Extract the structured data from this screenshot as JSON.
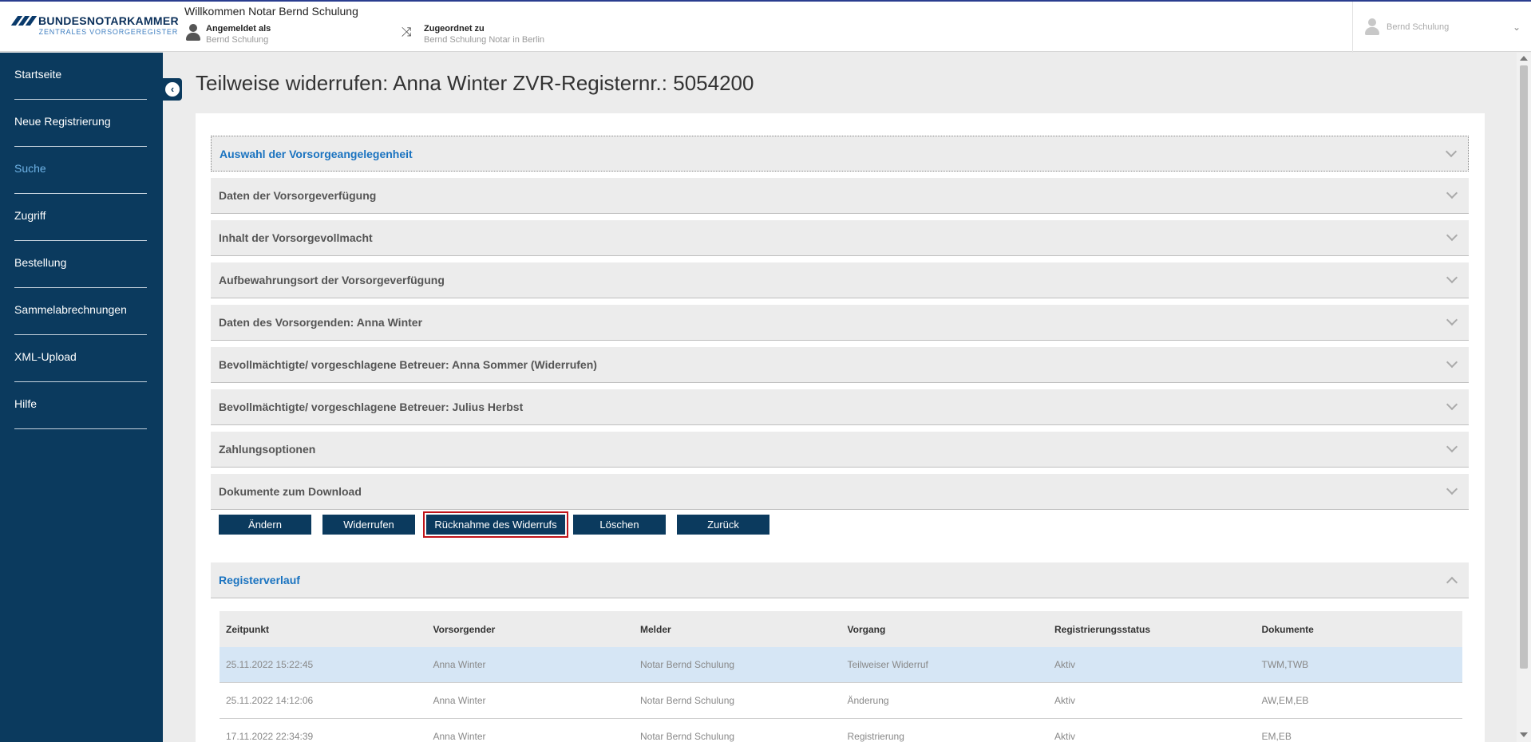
{
  "header": {
    "logo_name": "BUNDESNOTARKAMMER",
    "logo_sub": "ZENTRALES VORSORGEREGISTER",
    "welcome": "Willkommen Notar Bernd Schulung",
    "logged_in_label": "Angemeldet als",
    "logged_in_value": "Bernd Schulung",
    "assigned_label": "Zugeordnet zu",
    "assigned_value": "Bernd Schulung Notar in Berlin",
    "user_menu_name": "Bernd Schulung"
  },
  "sidebar": {
    "items": [
      {
        "label": "Startseite"
      },
      {
        "label": "Neue Registrierung"
      },
      {
        "label": "Suche"
      },
      {
        "label": "Zugriff"
      },
      {
        "label": "Bestellung"
      },
      {
        "label": "Sammelabrechnungen"
      },
      {
        "label": "XML-Upload"
      },
      {
        "label": "Hilfe"
      }
    ],
    "active": "Suche"
  },
  "page": {
    "title": "Teilweise widerrufen: Anna Winter ZVR-Registernr.: 5054200"
  },
  "accordion": [
    {
      "label": "Auswahl der Vorsorgeangelegenheit"
    },
    {
      "label": "Daten der Vorsorgeverfügung"
    },
    {
      "label": "Inhalt der Vorsorgevollmacht"
    },
    {
      "label": "Aufbewahrungsort der Vorsorgeverfügung"
    },
    {
      "label": "Daten des Vorsorgenden: Anna Winter"
    },
    {
      "label": "Bevollmächtigte/ vorgeschlagene Betreuer: Anna Sommer (Widerrufen)"
    },
    {
      "label": "Bevollmächtigte/ vorgeschlagene Betreuer: Julius Herbst"
    },
    {
      "label": "Zahlungsoptionen"
    },
    {
      "label": "Dokumente zum Download"
    }
  ],
  "actions": {
    "aendern": "Ändern",
    "widerrufen": "Widerrufen",
    "ruecknahme": "Rücknahme des Widerrufs",
    "loeschen": "Löschen",
    "zurueck": "Zurück"
  },
  "register": {
    "title": "Registerverlauf",
    "columns": [
      "Zeitpunkt",
      "Vorsorgender",
      "Melder",
      "Vorgang",
      "Registrierungsstatus",
      "Dokumente"
    ],
    "rows": [
      [
        "25.11.2022 15:22:45",
        "Anna Winter",
        "Notar Bernd Schulung",
        "Teilweiser Widerruf",
        "Aktiv",
        "TWM,TWB"
      ],
      [
        "25.11.2022 14:12:06",
        "Anna Winter",
        "Notar Bernd Schulung",
        "Änderung",
        "Aktiv",
        "AW,EM,EB"
      ],
      [
        "17.11.2022 22:34:39",
        "Anna Winter",
        "Notar Bernd Schulung",
        "Registrierung",
        "Aktiv",
        "EM,EB"
      ]
    ]
  },
  "colors": {
    "sidebar_bg": "#0b3a5e",
    "accent_blue": "#1a73c0",
    "highlight_border": "#c0141a",
    "selected_row": "#d6e6f5"
  }
}
